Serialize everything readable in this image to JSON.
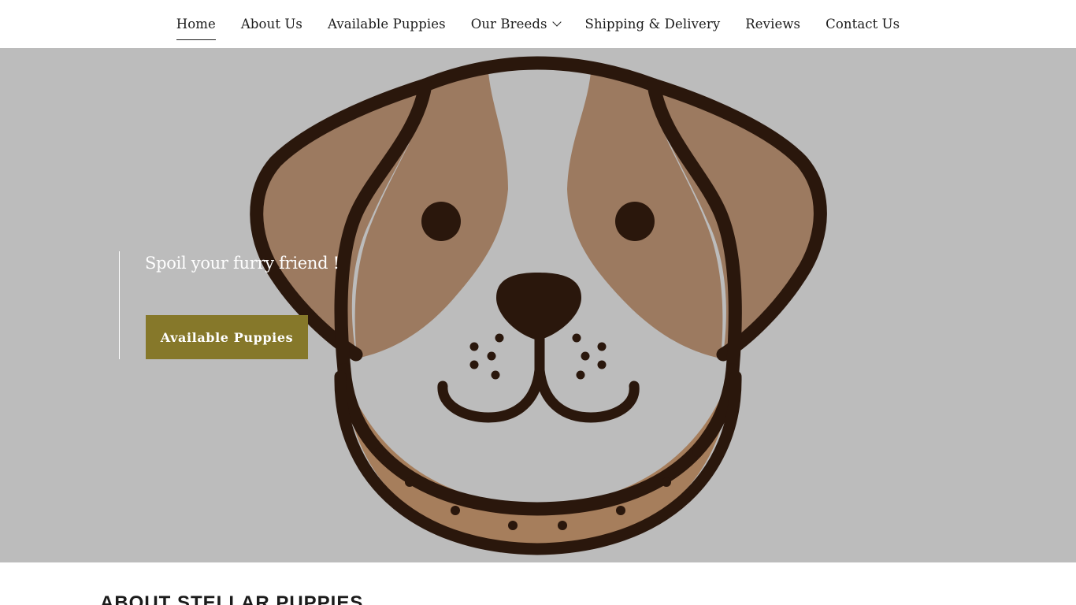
{
  "nav": {
    "items": [
      {
        "label": "Home"
      },
      {
        "label": "About Us"
      },
      {
        "label": "Available Puppies"
      },
      {
        "label": "Our Breeds"
      },
      {
        "label": "Shipping & Delivery"
      },
      {
        "label": "Reviews"
      },
      {
        "label": "Contact Us"
      }
    ],
    "active": "Home"
  },
  "hero": {
    "tagline": "Spoil your furry friend !",
    "cta_label": "Available Puppies",
    "image": "cartoon-dog-face-illustration"
  },
  "about": {
    "title": "ABOUT STELLAR PUPPIES"
  },
  "colors": {
    "hero_background": "#bcbcbc",
    "cta_background": "#86782a",
    "dog_outline": "#2a170c",
    "dog_fur": "#9c7a60",
    "dog_collar": "#a67e5c"
  }
}
